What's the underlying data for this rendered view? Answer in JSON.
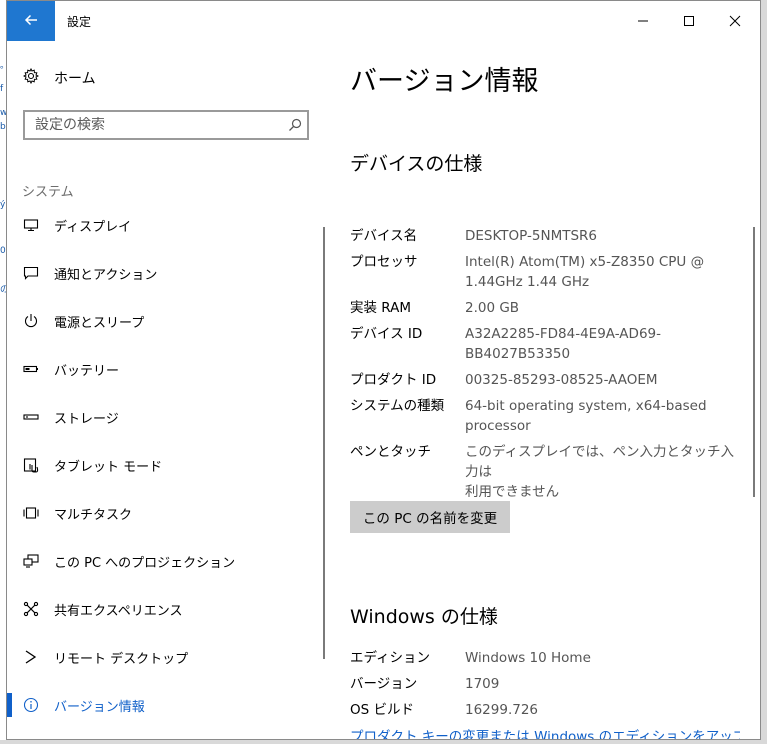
{
  "window": {
    "title": "設定",
    "controls": {
      "minimize": "minimize-icon",
      "maximize": "maximize-icon",
      "close": "close-icon"
    }
  },
  "sidebar": {
    "home_label": "ホーム",
    "search": {
      "placeholder": "設定の検索"
    },
    "section_header": "システム",
    "items": [
      {
        "label": "ディスプレイ",
        "icon": "display-icon"
      },
      {
        "label": "通知とアクション",
        "icon": "notification-icon"
      },
      {
        "label": "電源とスリープ",
        "icon": "power-icon"
      },
      {
        "label": "バッテリー",
        "icon": "battery-icon"
      },
      {
        "label": "ストレージ",
        "icon": "storage-icon"
      },
      {
        "label": "タブレット モード",
        "icon": "tablet-mode-icon"
      },
      {
        "label": "マルチタスク",
        "icon": "multitask-icon"
      },
      {
        "label": "この PC へのプロジェクション",
        "icon": "projection-icon"
      },
      {
        "label": "共有エクスペリエンス",
        "icon": "shared-experience-icon"
      },
      {
        "label": "リモート デスクトップ",
        "icon": "remote-desktop-icon"
      },
      {
        "label": "バージョン情報",
        "icon": "info-icon",
        "active": true
      }
    ]
  },
  "main": {
    "title": "バージョン情報",
    "device_spec": {
      "heading": "デバイスの仕様",
      "rows": [
        {
          "key": "デバイス名",
          "value": "DESKTOP-5NMTSR6"
        },
        {
          "key": "プロセッサ",
          "value": "Intel(R) Atom(TM) x5-Z8350  CPU @\n1.44GHz   1.44 GHz"
        },
        {
          "key": "実装 RAM",
          "value": "2.00 GB"
        },
        {
          "key": "デバイス ID",
          "value": "A32A2285-FD84-4E9A-AD69-\nBB4027B53350"
        },
        {
          "key": "プロダクト ID",
          "value": "00325-85293-08525-AAOEM"
        },
        {
          "key": "システムの種類",
          "value": "64-bit operating system, x64-based\nprocessor"
        },
        {
          "key": "ペンとタッチ",
          "value": "このディスプレイでは、ペン入力とタッチ入力は\n利用できません"
        }
      ],
      "rename_button": "この PC の名前を変更"
    },
    "windows_spec": {
      "heading": "Windows の仕様",
      "rows": [
        {
          "key": "エディション",
          "value": "Windows 10 Home"
        },
        {
          "key": "バージョン",
          "value": "1709"
        },
        {
          "key": "OS ビルド",
          "value": "16299.726"
        }
      ],
      "link": "プロダクト キーの変更または Windows のエディションをアップグレー"
    }
  },
  "colors": {
    "accent": "#1060c9",
    "titlebar_back": "#1f77d0",
    "button_bg": "#cccccc"
  }
}
